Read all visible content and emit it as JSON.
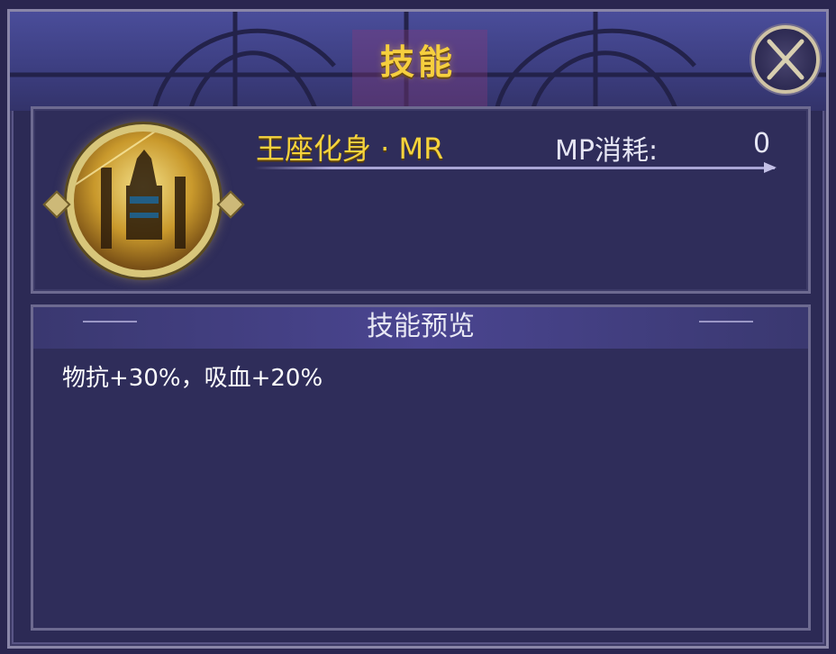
{
  "dialog": {
    "title": "技能",
    "close_icon": "x-close-icon"
  },
  "skill": {
    "name": "王座化身 · MR",
    "mp_label": "MP消耗:",
    "mp_value": "0",
    "portrait_icon": "anubis-throne-portrait"
  },
  "preview": {
    "header": "技能预览",
    "description": "物抗+30%，吸血+20%"
  },
  "colors": {
    "accent_gold": "#f5d33d",
    "panel_bg": "#2f2d5a",
    "border": "#8a86a8"
  }
}
